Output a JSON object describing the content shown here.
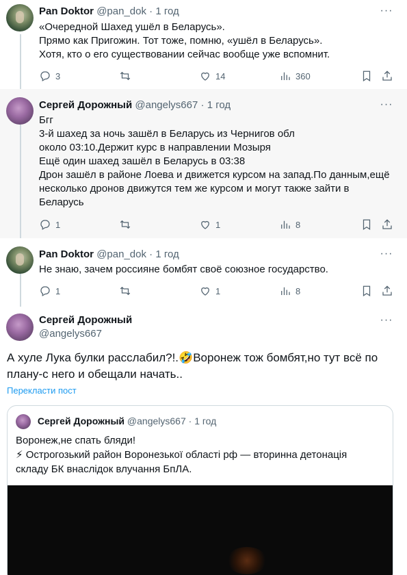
{
  "tweets": [
    {
      "name": "Pan Doktor",
      "handle": "@pan_dok",
      "dot": "·",
      "time": "1 год",
      "text": "«Очередной Шахед ушёл в Беларусь».\nПрямо как Пригожин. Тот тоже, помню, «ушёл в Беларусь».\nХотя, кто о его существовании сейчас вообще уже вспомнит.",
      "replies": "3",
      "retweets": "",
      "likes": "14",
      "views": "360"
    },
    {
      "name": "Сергей Дорожный",
      "handle": "@angelys667",
      "dot": "·",
      "time": "1 год",
      "text": "Бгг\n3-й шахед за ночь зашёл в Беларусь из Чернигов обл\nоколо 03:10.Держит курс в направлении Мозыря\nЕщё один шахед зашёл в Беларусь в 03:38\nДрон зашёл в районе Лоева и движется курсом на запад.По данным,ещё\nнесколько дронов движутся тем же курсом и могут также зайти в\nБеларусь",
      "replies": "1",
      "retweets": "",
      "likes": "1",
      "views": "8"
    },
    {
      "name": "Pan Doktor",
      "handle": "@pan_dok",
      "dot": "·",
      "time": "1 год",
      "text": "Не знаю, зачем россияне бомбят своё союзное государство.",
      "replies": "1",
      "retweets": "",
      "likes": "1",
      "views": "8"
    }
  ],
  "main": {
    "name": "Сергей Дорожный",
    "handle": "@angelys667",
    "text": "А хуле Лука булки расслабил?!.🤣Воронеж тож бомбят,но тут всё по\nплану-с него и обещали начать..",
    "translate": "Перекласти пост"
  },
  "quote": {
    "name": "Сергей Дорожный",
    "handle": "@angelys667",
    "dot": "·",
    "time": "1 год",
    "text": "Воронеж,не спать бляди!\n⚡ Острогозький район Воронезької області рф — вторинна детонація\nскладу БК внаслідок влучання БпЛА."
  },
  "more_glyph": "···",
  "colors": {
    "link": "#1d9bf0",
    "muted": "#536471",
    "highlight_bg": "#f7f7f7",
    "border": "#cfd9de"
  },
  "icons": [
    "reply-icon",
    "retweet-icon",
    "like-icon",
    "views-icon",
    "bookmark-icon",
    "share-icon",
    "more-icon"
  ]
}
